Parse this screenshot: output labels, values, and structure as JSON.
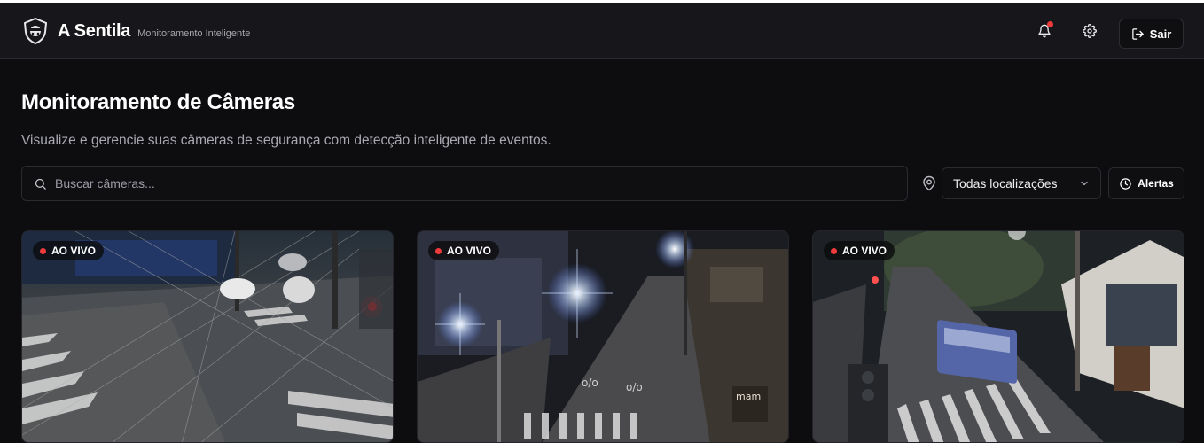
{
  "app": {
    "name": "A Sentila",
    "tagline": "Monitoramento Inteligente"
  },
  "header": {
    "notifications_icon": "bell-icon",
    "notification_badge_color": "#ef3a3a",
    "settings_icon": "gear-icon",
    "logout_icon": "log-out-icon",
    "logout_label": "Sair"
  },
  "page": {
    "title": "Monitoramento de Câmeras",
    "subtitle": "Visualize e gerencie suas câmeras de segurança com detecção inteligente de eventos."
  },
  "filters": {
    "search_placeholder": "Buscar câmeras...",
    "search_value": "",
    "location_icon": "map-pin-icon",
    "location_selected": "Todas localizações",
    "alerts_icon": "clock-icon",
    "alerts_label": "Alertas"
  },
  "cameras": [
    {
      "status": "AO VIVO",
      "scene": "night intersection with cars and crosswalks"
    },
    {
      "status": "AO VIVO",
      "scene": "night street with bright lamps"
    },
    {
      "status": "AO VIVO",
      "scene": "night avenue with bus and traffic light"
    }
  ],
  "colors": {
    "background": "#0d0d10",
    "header_bg": "#17171b",
    "live_dot": "#ef3b3b"
  }
}
